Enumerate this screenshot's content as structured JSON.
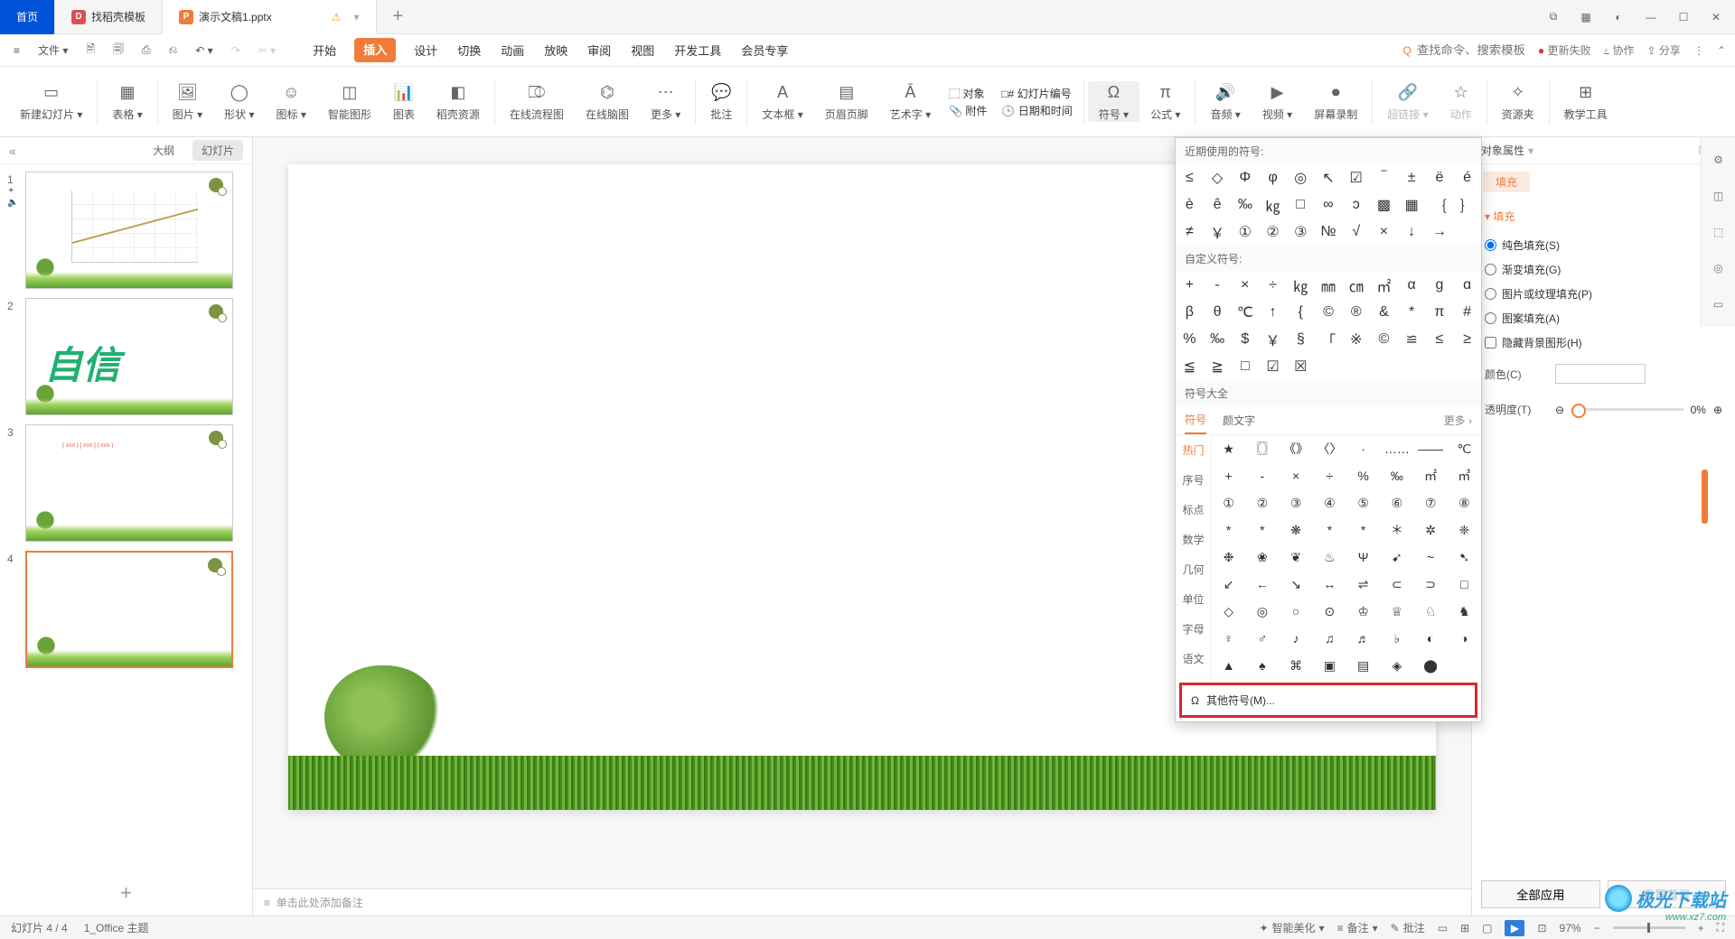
{
  "titlebar": {
    "home": "首页",
    "tab1": "找稻壳模板",
    "tab2": "演示文稿1.pptx",
    "add": "+"
  },
  "menubar": {
    "file": "文件",
    "tabs": [
      "开始",
      "插入",
      "设计",
      "切换",
      "动画",
      "放映",
      "审阅",
      "视图",
      "开发工具",
      "会员专享"
    ],
    "active_index": 1,
    "search_prompt": "查找命令、搜索模板",
    "update_fail": "更新失败",
    "coop": "协作",
    "share": "分享"
  },
  "ribbon": {
    "items": [
      "新建幻灯片",
      "表格",
      "图片",
      "形状",
      "图标",
      "智能图形",
      "图表",
      "稻壳资源",
      "在线流程图",
      "在线脑图",
      "更多",
      "批注",
      "文本框",
      "页眉页脚",
      "艺术字",
      "对象",
      "幻灯片编号",
      "日期和时间",
      "符号",
      "公式",
      "音频",
      "视频",
      "屏幕录制",
      "超链接",
      "动作",
      "资源夹",
      "教学工具"
    ],
    "attach": "附件"
  },
  "left_panel": {
    "tab_outline": "大纲",
    "tab_slides": "幻灯片",
    "slide2_text": "自信"
  },
  "symbol_popup": {
    "recent_title": "近期使用的符号:",
    "recent": [
      "≤",
      "◇",
      "Φ",
      "φ",
      "◎",
      "↖",
      "☑",
      "‾",
      "±",
      "ë",
      "é",
      "è",
      "ê",
      "‰",
      "㎏",
      "□",
      "∞",
      "ɔ",
      "▩",
      "▦",
      "｛",
      "｝",
      "≠",
      "￥",
      "①",
      "②",
      "③",
      "№",
      "√",
      "×",
      "↓",
      "→"
    ],
    "custom_title": "自定义符号:",
    "custom": [
      "+",
      "-",
      "×",
      "÷",
      "㎏",
      "㎜",
      "㎝",
      "㎡",
      "α",
      "ɡ",
      "ɑ",
      "β",
      "θ",
      "℃",
      "↑",
      "{",
      "©",
      "®",
      "&",
      "*",
      "π",
      "#",
      "%",
      "‰",
      "$",
      "￥",
      "§",
      "「",
      "※",
      "©",
      "≌",
      "≤",
      "≥",
      "≦",
      "≧",
      "□",
      "☑",
      "☒"
    ],
    "all_title": "符号大全",
    "tab_symbol": "符号",
    "tab_emoji": "颜文字",
    "more": "更多",
    "cats": [
      "热门",
      "序号",
      "标点",
      "数学",
      "几何",
      "单位",
      "字母",
      "语文"
    ],
    "grid": [
      "★",
      "〖〗",
      "《》",
      "〈〉",
      "·",
      "……",
      "——",
      "℃",
      "+",
      "-",
      "×",
      "÷",
      "%",
      "‰",
      "㎡",
      "㎥",
      "①",
      "②",
      "③",
      "④",
      "⑤",
      "⑥",
      "⑦",
      "⑧",
      "*",
      "*",
      "❋",
      "*",
      "*",
      "＊",
      "✲",
      "❈",
      "❉",
      "❀",
      "❦",
      "♨",
      "Ψ",
      "➹",
      "~",
      "➷",
      "↙",
      "←",
      "↘",
      "↔",
      "⇌",
      "⊂",
      "⊃",
      "□",
      "◇",
      "◎",
      "○",
      "⊙",
      "♔",
      "♕",
      "♘",
      "♞",
      "♀",
      "♂",
      "♪",
      "♫",
      "♬",
      "♭",
      "◐",
      "◑",
      "▲",
      "♠",
      "⌘",
      "▣",
      "▤",
      "◈",
      "⬤"
    ],
    "footer": "其他符号(M)..."
  },
  "props": {
    "title": "对象属性",
    "tab_fill": "填充",
    "section": "填充",
    "r_solid": "纯色填充(S)",
    "r_grad": "渐变填充(G)",
    "r_pict": "图片或纹理填充(P)",
    "r_patt": "图案填充(A)",
    "r_hide": "隐藏背景图形(H)",
    "color_label": "颜色(C)",
    "opacity_label": "透明度(T)",
    "opacity_val": "0%",
    "btn_applyall": "全部应用",
    "btn_resetbg": "重置背景"
  },
  "notes": {
    "placeholder": "单击此处添加备注"
  },
  "statusbar": {
    "slide_info": "幻灯片 4 / 4",
    "theme": "1_Office 主题",
    "beautify": "智能美化",
    "notes": "备注",
    "comments": "批注",
    "zoom": "97%"
  },
  "watermark": {
    "brand": "极光下载站",
    "url": "www.xz7.com"
  }
}
